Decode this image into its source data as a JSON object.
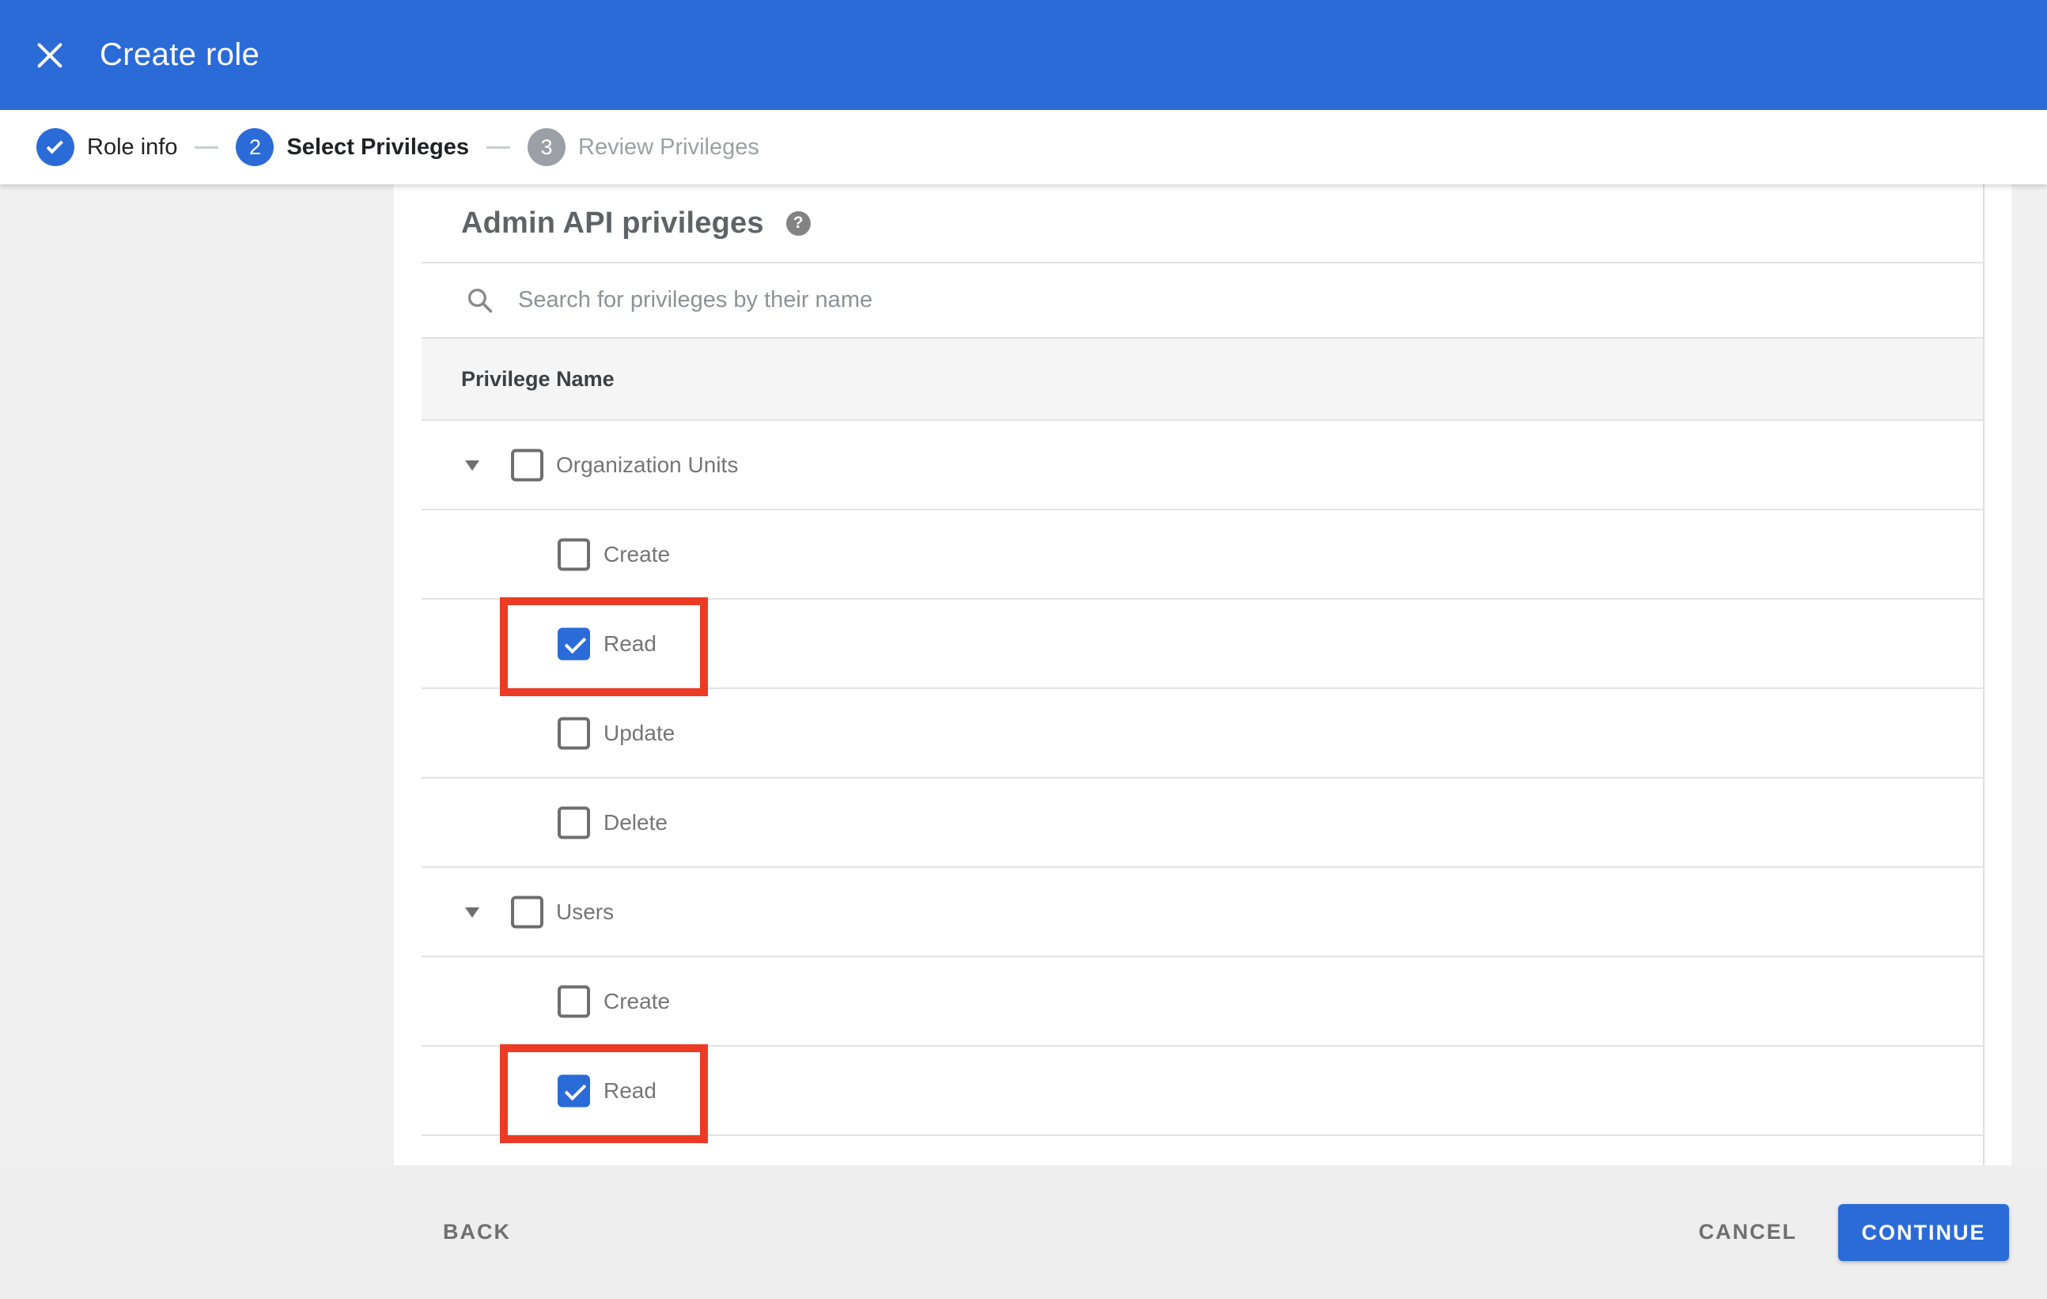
{
  "header": {
    "title": "Create role"
  },
  "stepper": {
    "steps": [
      {
        "label": "Role info",
        "state": "completed"
      },
      {
        "number": "2",
        "label": "Select Privileges",
        "state": "active"
      },
      {
        "number": "3",
        "label": "Review Privileges",
        "state": "upcoming"
      }
    ]
  },
  "panel": {
    "heading": "Admin API privileges",
    "help_glyph": "?",
    "search_placeholder": "Search for privileges by their name",
    "column_header": "Privilege Name",
    "rows": [
      {
        "label": "Organization Units",
        "level": "parent",
        "checked": false,
        "expanded": true,
        "highlighted": false
      },
      {
        "label": "Create",
        "level": "child",
        "checked": false,
        "highlighted": false
      },
      {
        "label": "Read",
        "level": "child",
        "checked": true,
        "highlighted": true
      },
      {
        "label": "Update",
        "level": "child",
        "checked": false,
        "highlighted": false
      },
      {
        "label": "Delete",
        "level": "child",
        "checked": false,
        "highlighted": false
      },
      {
        "label": "Users",
        "level": "parent",
        "checked": false,
        "expanded": true,
        "highlighted": false
      },
      {
        "label": "Create",
        "level": "child",
        "checked": false,
        "highlighted": false
      },
      {
        "label": "Read",
        "level": "child",
        "checked": true,
        "highlighted": true
      }
    ]
  },
  "footer": {
    "back_label": "BACK",
    "cancel_label": "CANCEL",
    "continue_label": "CONTINUE"
  },
  "colors": {
    "primary_blue": "#2b6bd8",
    "highlight_red": "#ec3b24",
    "inactive_gray": "#9aa0a6",
    "divider": "#e3e3e3",
    "label_gray": "#757575",
    "header_text_gray": "#5f6368"
  }
}
